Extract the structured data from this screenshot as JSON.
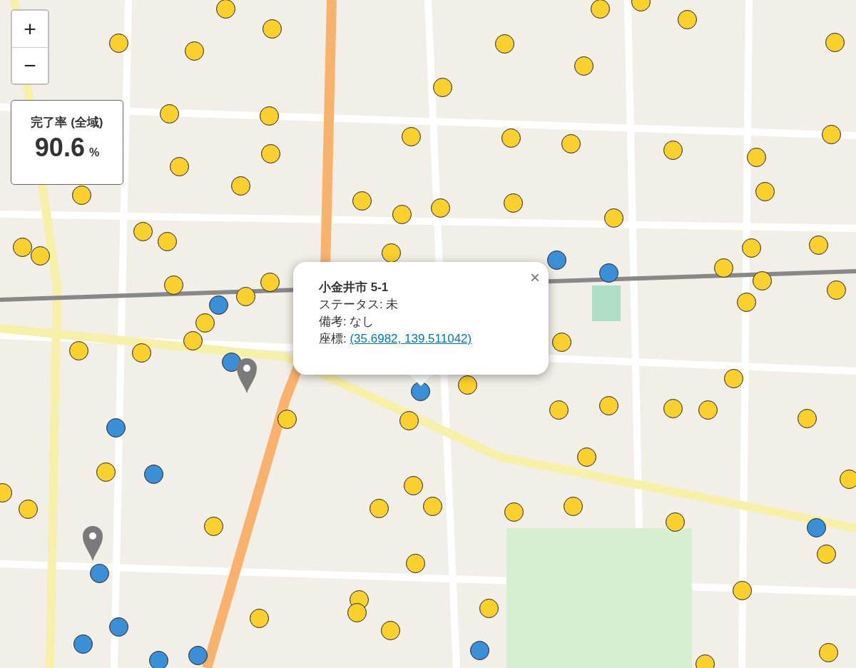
{
  "zoom_control": {
    "buttons": [
      "+",
      "−"
    ]
  },
  "completion_panel": {
    "title": "完了率 (全域)",
    "value": "90.6",
    "unit": "%"
  },
  "markers": [
    {
      "kind": "dot",
      "color": "#fad02c"
    },
    {
      "kind": "dot",
      "color": "#fad02c"
    },
    {
      "kind": "dot",
      "color": "#fad02c"
    },
    {
      "kind": "dot",
      "color": "#fad02c"
    },
    {
      "kind": "dot",
      "color": "#fad02c"
    },
    {
      "kind": "dot",
      "color": "#fad02c"
    },
    {
      "kind": "dot",
      "color": "#fad02c"
    },
    {
      "kind": "dot",
      "color": "#fad02c"
    },
    {
      "kind": "dot",
      "color": "#fad02c"
    },
    {
      "kind": "dot",
      "color": "#fad02c"
    },
    {
      "kind": "dot",
      "color": "#fad02c"
    },
    {
      "kind": "dot",
      "color": "#fad02c"
    },
    {
      "kind": "dot",
      "color": "#fad02c"
    },
    {
      "kind": "dot",
      "color": "#fad02c"
    },
    {
      "kind": "dot",
      "color": "#fad02c"
    },
    {
      "kind": "dot",
      "color": "#fad02c"
    },
    {
      "kind": "dot",
      "color": "#fad02c"
    },
    {
      "kind": "dot",
      "color": "#fad02c"
    },
    {
      "kind": "dot",
      "color": "#fad02c"
    },
    {
      "kind": "dot",
      "color": "#fad02c"
    },
    {
      "kind": "dot",
      "color": "#fad02c"
    },
    {
      "kind": "dot",
      "color": "#fad02c"
    },
    {
      "kind": "dot",
      "color": "#fad02c"
    },
    {
      "kind": "dot",
      "color": "#fad02c"
    },
    {
      "kind": "dot",
      "color": "#fad02c"
    },
    {
      "kind": "dot",
      "color": "#fad02c"
    },
    {
      "kind": "dot",
      "color": "#fad02c"
    },
    {
      "kind": "dot",
      "color": "#fad02c"
    },
    {
      "kind": "dot",
      "color": "#fad02c"
    },
    {
      "kind": "dot",
      "color": "#fad02c"
    },
    {
      "kind": "dot",
      "color": "#fad02c"
    },
    {
      "kind": "dot",
      "color": "#fad02c"
    },
    {
      "kind": "dot",
      "color": "#fad02c"
    },
    {
      "kind": "dot",
      "color": "#fad02c"
    },
    {
      "kind": "dot",
      "color": "#fad02c"
    },
    {
      "kind": "dot",
      "color": "#fad02c"
    },
    {
      "kind": "dot",
      "color": "#fad02c"
    },
    {
      "kind": "dot",
      "color": "#fad02c"
    },
    {
      "kind": "dot",
      "color": "#fad02c"
    },
    {
      "kind": "dot",
      "color": "#fad02c"
    },
    {
      "kind": "dot",
      "color": "#fad02c"
    },
    {
      "kind": "dot",
      "color": "#fad02c"
    },
    {
      "kind": "dot",
      "color": "#fad02c"
    },
    {
      "kind": "dot",
      "color": "#fad02c"
    },
    {
      "kind": "dot",
      "color": "#fad02c"
    },
    {
      "kind": "dot",
      "color": "#fad02c"
    },
    {
      "kind": "dot",
      "color": "#fad02c"
    },
    {
      "kind": "dot",
      "color": "#fad02c"
    },
    {
      "kind": "dot",
      "color": "#fad02c"
    },
    {
      "kind": "dot",
      "color": "#fad02c"
    },
    {
      "kind": "dot",
      "color": "#fad02c"
    },
    {
      "kind": "dot",
      "color": "#fad02c"
    },
    {
      "kind": "dot",
      "color": "#fad02c"
    },
    {
      "kind": "dot",
      "color": "#fad02c"
    },
    {
      "kind": "dot",
      "color": "#fad02c"
    },
    {
      "kind": "dot",
      "color": "#fad02c"
    },
    {
      "kind": "dot",
      "color": "#fad02c"
    },
    {
      "kind": "dot",
      "color": "#fad02c"
    },
    {
      "kind": "dot",
      "color": "#fad02c"
    },
    {
      "kind": "dot",
      "color": "#fad02c"
    },
    {
      "kind": "dot",
      "color": "#fad02c"
    },
    {
      "kind": "dot",
      "color": "#fad02c"
    },
    {
      "kind": "dot",
      "color": "#fad02c"
    },
    {
      "kind": "dot",
      "color": "#fad02c"
    },
    {
      "kind": "dot",
      "color": "#fad02c"
    },
    {
      "kind": "dot",
      "color": "#fad02c"
    },
    {
      "kind": "dot",
      "color": "#fad02c"
    },
    {
      "kind": "dot",
      "color": "#fad02c"
    },
    {
      "kind": "dot",
      "color": "#fad02c"
    },
    {
      "kind": "dot",
      "color": "#fad02c"
    },
    {
      "kind": "dot",
      "color": "#fad02c"
    },
    {
      "kind": "dot",
      "color": "#fad02c"
    },
    {
      "kind": "dot",
      "color": "#fad02c"
    },
    {
      "kind": "dot",
      "color": "#fad02c"
    },
    {
      "kind": "dot",
      "color": "#fad02c"
    },
    {
      "kind": "dot",
      "color": "#fad02c"
    },
    {
      "kind": "dot",
      "color": "#fad02c"
    },
    {
      "kind": "dot",
      "color": "#fad02c"
    },
    {
      "kind": "dot",
      "color": "#fad02c"
    },
    {
      "kind": "dot",
      "color": "#3a8fd6"
    },
    {
      "kind": "dot",
      "color": "#3a8fd6"
    },
    {
      "kind": "dot",
      "color": "#3a8fd6"
    },
    {
      "kind": "dot",
      "color": "#3a8fd6"
    },
    {
      "kind": "dot",
      "color": "#3a8fd6"
    },
    {
      "kind": "dot",
      "color": "#3a8fd6"
    },
    {
      "kind": "dot",
      "color": "#3a8fd6"
    },
    {
      "kind": "dot",
      "color": "#3a8fd6"
    },
    {
      "kind": "dot",
      "color": "#3a8fd6"
    },
    {
      "kind": "dot",
      "color": "#3a8fd6"
    },
    {
      "kind": "dot",
      "color": "#3a8fd6"
    },
    {
      "kind": "dot",
      "color": "#3a8fd6"
    },
    {
      "kind": "dot",
      "color": "#3a8fd6"
    },
    {
      "kind": "dot",
      "color": "#3a8fd6"
    },
    {
      "kind": "pin"
    },
    {
      "kind": "pin"
    }
  ],
  "popup": {
    "title": "小金井市 5-1",
    "lines": [
      "ステータス: 未",
      "備考: なし"
    ],
    "coord_label": "座標:",
    "coord_link": "(35.6982, 139.511042)",
    "close": "×"
  }
}
